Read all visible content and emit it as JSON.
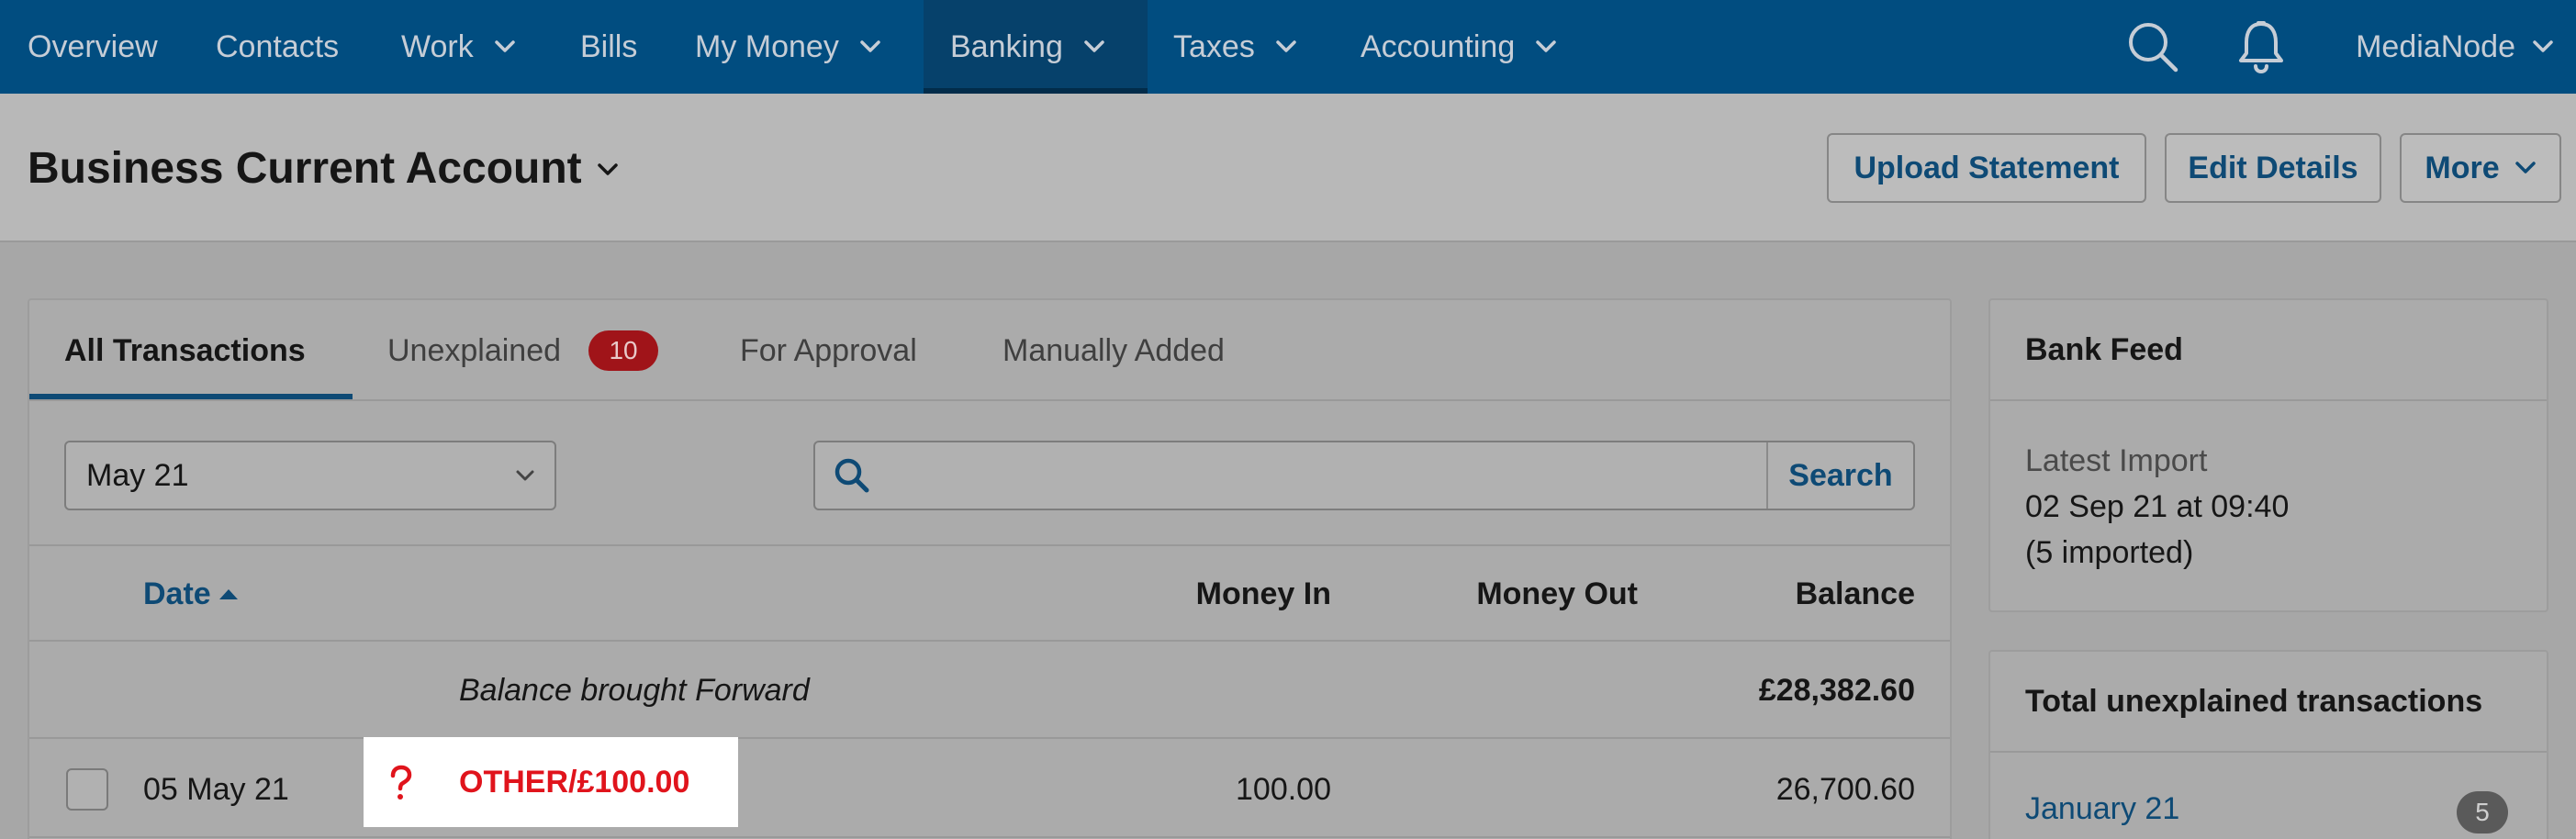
{
  "topnav": {
    "items": [
      {
        "label": "Overview",
        "has_menu": false
      },
      {
        "label": "Contacts",
        "has_menu": false
      },
      {
        "label": "Work",
        "has_menu": true
      },
      {
        "label": "Bills",
        "has_menu": false
      },
      {
        "label": "My Money",
        "has_menu": true
      },
      {
        "label": "Banking",
        "has_menu": true,
        "active": true
      },
      {
        "label": "Taxes",
        "has_menu": true
      },
      {
        "label": "Accounting",
        "has_menu": true
      }
    ],
    "search_icon": "search-icon",
    "notifications_icon": "bell-icon",
    "account_label": "MediaNode"
  },
  "header": {
    "title": "Business Current Account",
    "buttons": {
      "upload": "Upload Statement",
      "edit": "Edit Details",
      "more": "More"
    }
  },
  "transactions": {
    "tabs": [
      {
        "label": "All Transactions",
        "active": true
      },
      {
        "label": "Unexplained",
        "badge": "10"
      },
      {
        "label": "For Approval"
      },
      {
        "label": "Manually Added"
      }
    ],
    "filter": {
      "month": "May 21",
      "search_placeholder": "",
      "search_button": "Search"
    },
    "columns": {
      "date": "Date",
      "money_in": "Money In",
      "money_out": "Money Out",
      "balance": "Balance"
    },
    "brought_forward": {
      "label": "Balance brought Forward",
      "balance": "£28,382.60"
    },
    "rows": [
      {
        "date": "05 May 21",
        "description": "OTHER/£100.00",
        "status_icon": "question-mark-icon",
        "money_in": "100.00",
        "money_out": "",
        "balance": "26,700.60"
      }
    ]
  },
  "bank_feed": {
    "title": "Bank Feed",
    "latest_import_label": "Latest Import",
    "latest_import_time": "02 Sep 21 at 09:40",
    "imported_count": "(5 imported)"
  },
  "unexplained": {
    "title": "Total unexplained transactions",
    "items": [
      {
        "month": "January 21",
        "count": "5"
      }
    ]
  },
  "colors": {
    "nav_background": "#014d80",
    "accent_blue": "#0e4a75",
    "badge_red": "#a01419",
    "unexplained_text": "#e0141c"
  }
}
